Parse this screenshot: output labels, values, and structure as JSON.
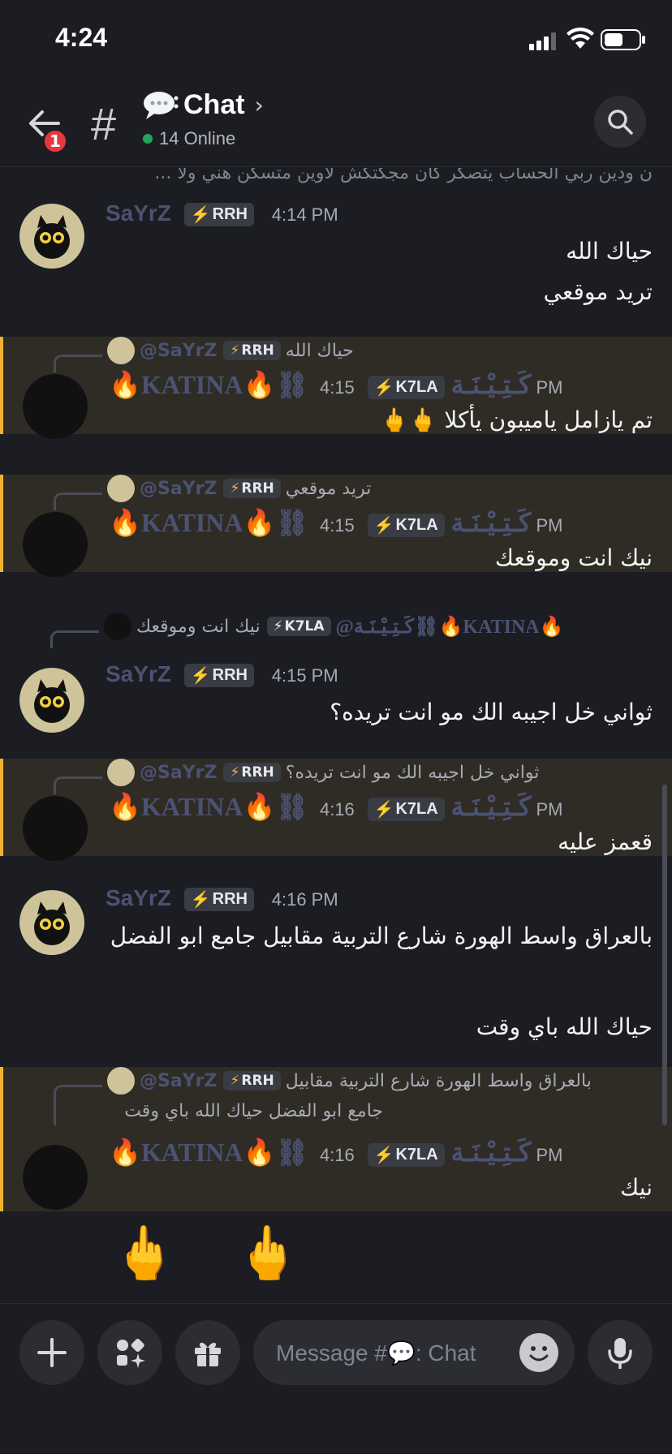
{
  "status": {
    "time": "4:24"
  },
  "header": {
    "badge": "1",
    "channel": "Chat",
    "online": "14 Online"
  },
  "clipped_top_text": "ن ودين ربي الحساب يتصكر كان مجكتكش لاوين متسكن هني ولا ...",
  "messages": [
    {
      "user": "SaYrZ",
      "tag": "RRH",
      "time": "4:14 PM",
      "lines": [
        "حياك الله",
        "تريد موقعي"
      ]
    },
    {
      "reply_user": "@SaYrZ",
      "reply_tag": "RRH",
      "reply_text": "حياك الله",
      "user": "🔥KATINA🔥⛓كَـتِـيْـنَـة",
      "tag": "K7LA",
      "time": "4:15 PM",
      "lines": [
        "تم يازامل ياميبون يأكلا 🖕🖕"
      ]
    },
    {
      "reply_user": "@SaYrZ",
      "reply_tag": "RRH",
      "reply_text": "تريد موقعي",
      "user": "🔥KATINA🔥⛓كَـتِـيْـنَـة",
      "tag": "K7LA",
      "time": "4:15 PM",
      "lines": [
        "نيك انت وموقعك"
      ]
    },
    {
      "reply_user": "@كَـتِـيْـنَـة⛓🔥KATINA🔥",
      "reply_tag": "K7LA",
      "reply_text": "نيك انت وموقعك",
      "user": "SaYrZ",
      "tag": "RRH",
      "time": "4:15 PM",
      "lines": [
        "ثواني خل اجيبه الك مو انت تريده؟"
      ]
    },
    {
      "reply_user": "@SaYrZ",
      "reply_tag": "RRH",
      "reply_text": "ثواني خل اجيبه الك مو انت تريده؟",
      "user": "🔥KATINA🔥⛓كَـتِـيْـنَـة",
      "tag": "K7LA",
      "time": "4:16 PM",
      "lines": [
        "قعمز عليه"
      ]
    },
    {
      "user": "SaYrZ",
      "tag": "RRH",
      "time": "4:16 PM",
      "lines": [
        "بالعراق واسط الهورة شارع التربية مقابيل جامع ابو الفضل",
        "حياك الله باي وقت"
      ]
    },
    {
      "reply_user": "@SaYrZ",
      "reply_tag": "RRH",
      "reply_text": "بالعراق واسط الهورة شارع التربية مقابيل",
      "reply_text2": "جامع ابو الفضل   حياك الله باي وقت",
      "user": "🔥KATINA🔥⛓كَـتِـيْـنَـة",
      "tag": "K7LA",
      "time": "4:16 PM",
      "lines": [
        "نيك"
      ],
      "emoji_line": "🖕 🖕"
    }
  ],
  "composer": {
    "placeholder": "Message #💬: Chat"
  },
  "colors": {
    "background": "#1c1d22",
    "mention": "#f0b232",
    "online": "#23a55a",
    "badge": "#e5383f"
  }
}
